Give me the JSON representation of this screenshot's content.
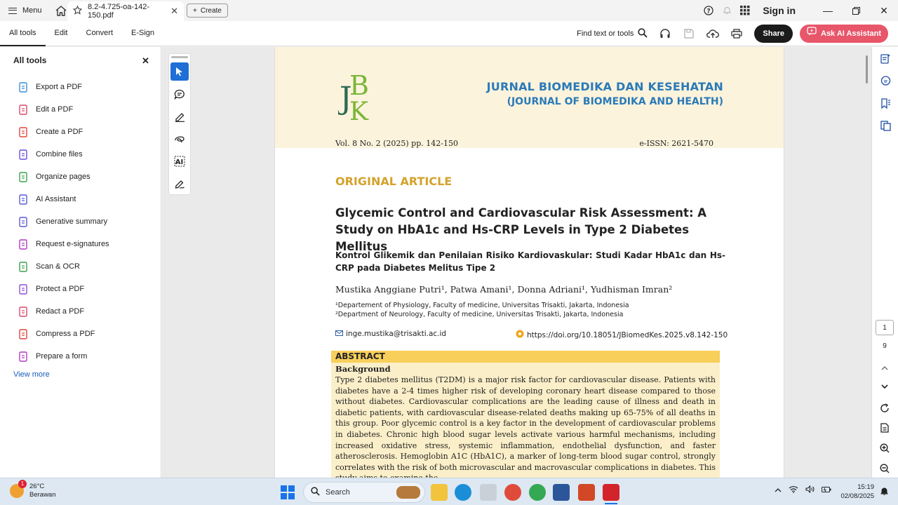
{
  "titlebar": {
    "menu_label": "Menu",
    "tab_title": "8.2-4.725-oa-142-150.pdf",
    "create_label": "Create",
    "signin_label": "Sign in"
  },
  "toolbar": {
    "tabs": [
      "All tools",
      "Edit",
      "Convert",
      "E-Sign"
    ],
    "find_label": "Find text or tools",
    "share_label": "Share",
    "ai_label": "Ask AI Assistant"
  },
  "left_panel": {
    "title": "All tools",
    "items": [
      {
        "label": "Export a PDF",
        "icon": "export-pdf-icon",
        "color": "#3a8ed8"
      },
      {
        "label": "Edit a PDF",
        "icon": "edit-pdf-icon",
        "color": "#d94a6a"
      },
      {
        "label": "Create a PDF",
        "icon": "create-pdf-icon",
        "color": "#e0433c"
      },
      {
        "label": "Combine files",
        "icon": "combine-files-icon",
        "color": "#6a4fd8"
      },
      {
        "label": "Organize pages",
        "icon": "organize-pages-icon",
        "color": "#3aa04a"
      },
      {
        "label": "AI Assistant",
        "icon": "ai-assistant-icon",
        "color": "#5b5bd6"
      },
      {
        "label": "Generative summary",
        "icon": "generative-summary-icon",
        "color": "#5b5bd6"
      },
      {
        "label": "Request e-signatures",
        "icon": "request-esignatures-icon",
        "color": "#b03cc0"
      },
      {
        "label": "Scan & OCR",
        "icon": "scan-ocr-icon",
        "color": "#3aa04a"
      },
      {
        "label": "Protect a PDF",
        "icon": "protect-pdf-icon",
        "color": "#8a4fd8"
      },
      {
        "label": "Redact a PDF",
        "icon": "redact-pdf-icon",
        "color": "#d94a6a"
      },
      {
        "label": "Compress a PDF",
        "icon": "compress-pdf-icon",
        "color": "#e0433c"
      },
      {
        "label": "Prepare a form",
        "icon": "prepare-form-icon",
        "color": "#b03cc0"
      }
    ],
    "view_more": "View more"
  },
  "document": {
    "journal_name": "JURNAL BIOMEDIKA DAN KESEHATAN",
    "journal_name_en": "(JOURNAL OF BIOMEDIKA AND HEALTH)",
    "volume": "Vol. 8  No. 2 (2025) pp. 142-150",
    "issn": "e-ISSN: 2621-5470",
    "article_type": "ORIGINAL ARTICLE",
    "title_en": "Glycemic Control and Cardiovascular Risk Assessment: A Study on HbA1c and Hs-CRP Levels in Type 2 Diabetes Mellitus",
    "title_id": "Kontrol Glikemik dan Penilaian Risiko Kardiovaskular: Studi  Kadar HbA1c dan Hs-CRP pada Diabetes Melitus Tipe 2",
    "authors": "Mustika Anggiane Putri¹, Patwa Amani¹, Donna Adriani¹, Yudhisman Imran²",
    "affiliation_1": "¹Departement of Physiology, Faculty of medicine, Universitas Trisakti, Jakarta, Indonesia",
    "affiliation_2": "²Department of Neurology, Faculty of medicine, Universitas Trisakti, Jakarta, Indonesia",
    "email": "inge.mustika@trisakti.ac.id",
    "doi": "https://doi.org/10.18051/JBiomedKes.2025.v8.142-150",
    "abstract_heading": "ABSTRACT",
    "background_label": "Background",
    "abstract_text": "Type 2 diabetes mellitus (T2DM) is a major risk factor for cardiovascular disease. Patients with diabetes have a 2-4 times higher risk of developing coronary heart disease compared to those without diabetes. Cardiovascular complications are the leading cause of illness and death in diabetic patients, with cardiovascular disease-related deaths making up 65-75% of all deaths in this group. Poor glycemic control is a key factor in the development of cardiovascular problems in diabetes. Chronic high blood sugar levels activate various harmful mechanisms, including increased oxidative stress, systemic inflammation, endothelial dysfunction, and faster atherosclerosis. Hemoglobin A1C (HbA1C), a marker of long-term blood sugar control, strongly correlates with the risk of both microvascular and macrovascular complications in diabetes. This study aims to examine the"
  },
  "page_nav": {
    "current_page": "1",
    "total_pages": "9"
  },
  "taskbar": {
    "temperature": "26°C",
    "weather": "Berawan",
    "weather_badge": "1",
    "search_label": "Search",
    "time": "15:19",
    "date": "02/08/2025"
  },
  "colors": {
    "journal_blue": "#2a7ab8",
    "article_gold": "#d4a22c",
    "abstract_head": "#f7cf5a",
    "abstract_body": "#fbefc9",
    "ai_button": "#e8566a"
  }
}
